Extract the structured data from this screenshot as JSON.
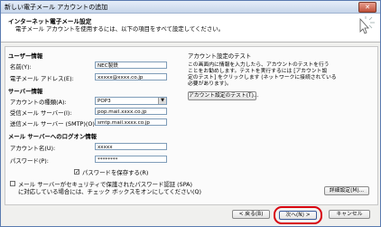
{
  "window": {
    "title": "新しい電子メール アカウントの追加",
    "close_label": "✕"
  },
  "header": {
    "title": "インターネット電子メール設定",
    "subtitle": "電子メール アカウントを使用するには、以下の項目をすべて設定してください。"
  },
  "user_info": {
    "heading": "ユーザー情報",
    "name_label": "名前(Y):",
    "name_value": "NEC製鉄",
    "email_label": "電子メール アドレス(E):",
    "email_value": "xxxxx@xxxx.co.jp"
  },
  "server_info": {
    "heading": "サーバー情報",
    "account_type_label": "アカウントの種類(A):",
    "account_type_value": "POP3",
    "incoming_label": "受信メール サーバー(I):",
    "incoming_value": "pop.mail.xxxx.co.jp",
    "outgoing_label": "送信メール サーバー (SMTP)(O):",
    "outgoing_value": "smtp.mail.xxxx.co.jp"
  },
  "logon_info": {
    "heading": "メール サーバーへのログオン情報",
    "account_label": "アカウント名(U):",
    "account_value": "xxxxx",
    "password_label": "パスワード(P):",
    "password_value": "********",
    "save_password_label": "パスワードを保存する(R)",
    "save_password_checked": true,
    "spa_label_line1": "メール サーバーがセキュリティで保護されたパスワード認証 (SPA)",
    "spa_label_line2": "に対応している場合には、チェック ボックスをオンにしてください(Q)",
    "spa_checked": false
  },
  "test": {
    "heading": "アカウント設定のテスト",
    "desc_lines": [
      "この画面内に情報を入力したら、アカウントのテストを行う",
      "ことをお勧めします。テストを実行するには [アカウント設",
      "定のテスト] をクリックします (ネットワークに接続されている",
      "必要があります)。"
    ],
    "button_label": "アカウント設定のテスト(T)..."
  },
  "advanced_button_label": "詳細設定(M)...",
  "footer": {
    "back_label": "< 戻る(B)",
    "next_label": "次へ(N) >",
    "cancel_label": "キャンセル"
  },
  "colors": {
    "highlight": "#d8000f",
    "title_bar": "#c6d5ea",
    "dialog_bg": "#f0f0ee"
  }
}
